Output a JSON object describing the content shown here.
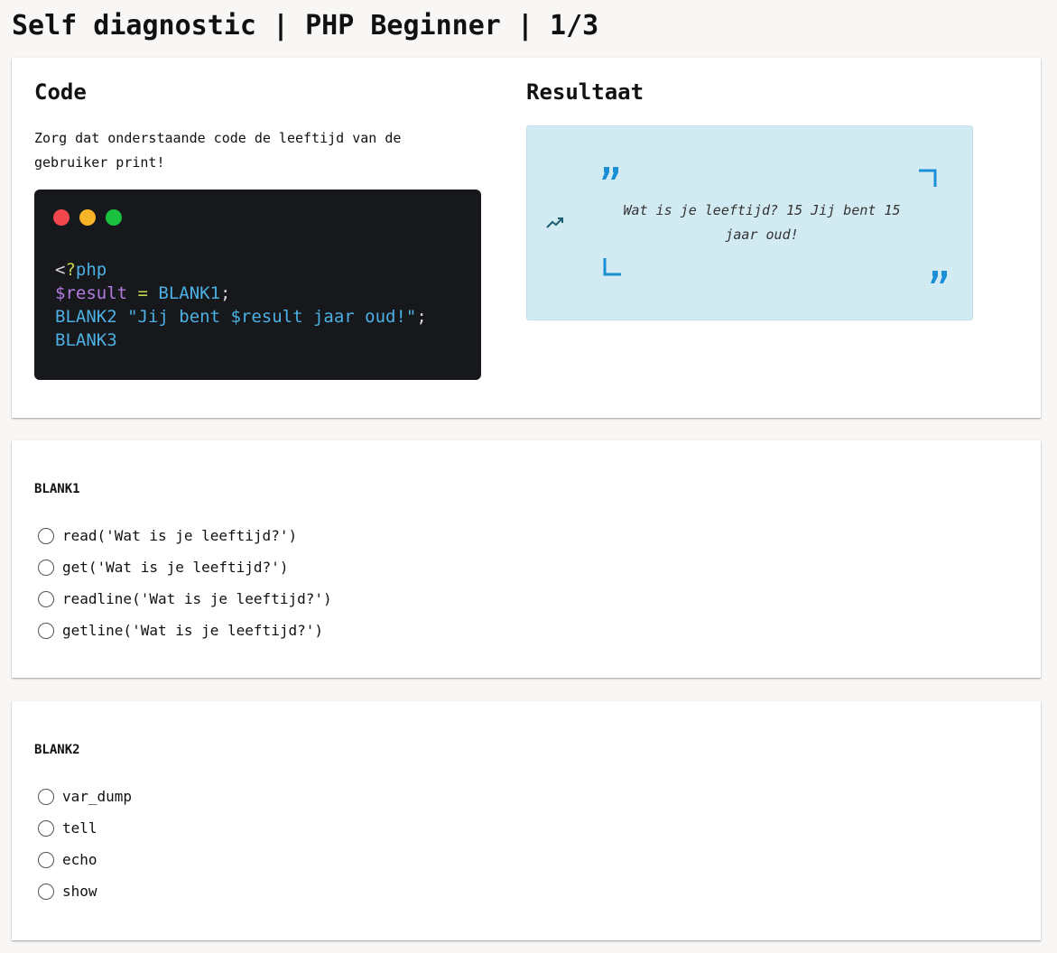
{
  "page": {
    "title": "Self diagnostic | PHP Beginner | 1/3"
  },
  "code_panel": {
    "heading": "Code",
    "instruction": "Zorg dat onderstaande code de leeftijd van de gebruiker print!",
    "editor": {
      "window_buttons": [
        "red",
        "yellow",
        "green"
      ],
      "lines": {
        "l1": {
          "punct": "<",
          "q": "?",
          "kw": "php"
        },
        "l2": {
          "var": "$result",
          "op": " = ",
          "blank": "BLANK1",
          "end": ";"
        },
        "l3": {
          "blank": "BLANK2",
          "str": " \"Jij bent $result jaar oud!\"",
          "end": ";"
        },
        "l4": {
          "blank": "BLANK3"
        }
      }
    }
  },
  "result_panel": {
    "heading": "Resultaat",
    "output": "Wat is je leeftijd? 15 Jij bent 15 jaar oud!",
    "icons": [
      "trending-up-icon",
      "quote-open-icon",
      "quote-close-icon"
    ]
  },
  "questions": [
    {
      "label": "BLANK1",
      "options": [
        "read('Wat is je leeftijd?')",
        "get('Wat is je leeftijd?')",
        "readline('Wat is je leeftijd?')",
        "getline('Wat is je leeftijd?')"
      ]
    },
    {
      "label": "BLANK2",
      "options": [
        "var_dump",
        "tell",
        "echo",
        "show"
      ]
    }
  ],
  "colors": {
    "page_bg": "#f8f7f5",
    "editor_bg": "#16181b",
    "code_blue": "#4cb0e4",
    "code_purple": "#b47ce0",
    "result_bg": "#d2eaf2",
    "accent_blue": "#1a8fd6"
  }
}
